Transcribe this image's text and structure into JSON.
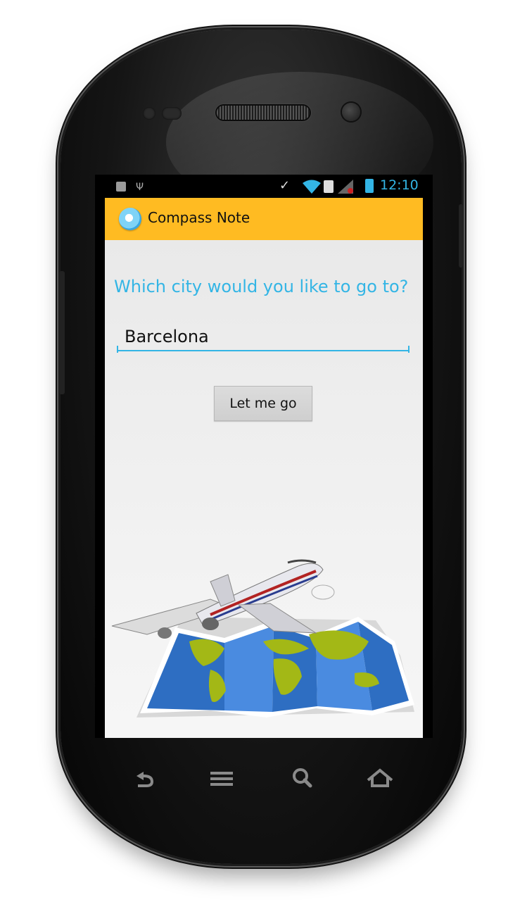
{
  "status_bar": {
    "time": "12:10",
    "icons": [
      "usb-debug-icon",
      "usb-icon",
      "mute-icon",
      "wifi-icon",
      "no-sim-icon",
      "signal-icon",
      "battery-charging-icon"
    ]
  },
  "action_bar": {
    "app_icon": "compass-icon",
    "title": "Compass Note",
    "background": "#ffbb22"
  },
  "main": {
    "question": "Which city would you like to go to?",
    "city_input_value": "Barcelona",
    "go_button_label": "Let me go",
    "illustration": "airplane-over-world-map"
  },
  "nav_bar": {
    "buttons": [
      "back-icon",
      "menu-icon",
      "search-icon",
      "home-icon"
    ]
  },
  "colors": {
    "accent": "#33b5e5",
    "action_bar": "#ffbb22",
    "background": "#ececec"
  }
}
